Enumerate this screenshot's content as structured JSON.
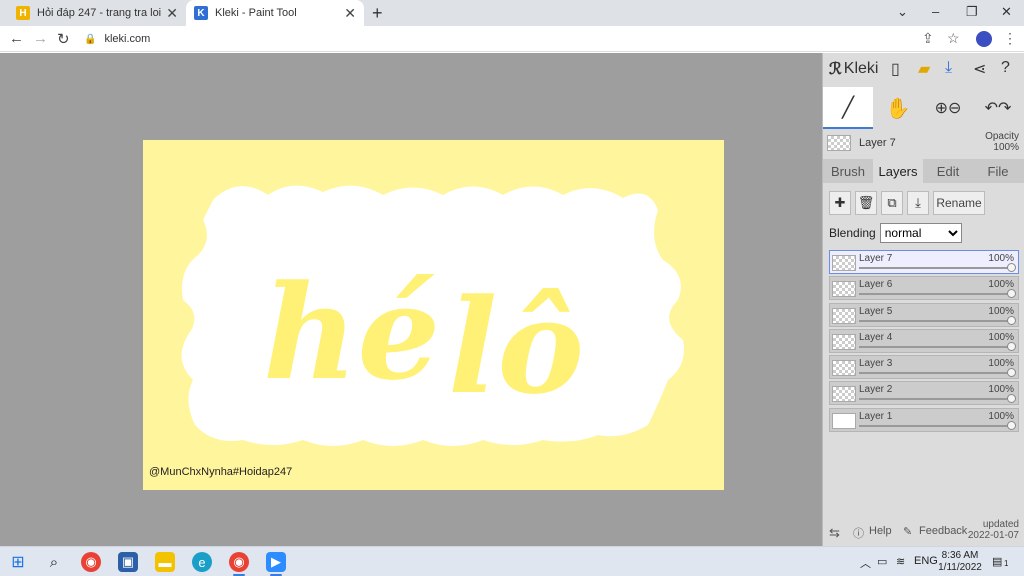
{
  "browser": {
    "tabs": [
      {
        "title": "Hỏi đáp 247 - trang tra loi",
        "favicon": "hoidap-favicon"
      },
      {
        "title": "Kleki - Paint Tool",
        "favicon": "kleki-favicon"
      }
    ],
    "new_tab": "+",
    "url": "kleki.com",
    "window_controls": {
      "minimize": "–",
      "maximize": "❐",
      "close": "✕",
      "dropdown": "⌄"
    }
  },
  "canvas": {
    "text_left": "hé",
    "text_right": "lô",
    "credit": "@MunChxNynha#Hoidap247",
    "colors": {
      "frame": "#fff59d",
      "letters": "#fff176",
      "background": "#ffffff"
    }
  },
  "panel": {
    "logo_text": "Kleki",
    "current_layer": "Layer 7",
    "opacity_label": "Opacity",
    "opacity_value": "100%",
    "tabs": [
      "Brush",
      "Layers",
      "Edit",
      "File"
    ],
    "active_tab": "Layers",
    "rename_label": "Rename",
    "blending_label": "Blending",
    "blending_value": "normal",
    "layers": [
      {
        "name": "Layer 7",
        "opacity": "100%"
      },
      {
        "name": "Layer 6",
        "opacity": "100%"
      },
      {
        "name": "Layer 5",
        "opacity": "100%"
      },
      {
        "name": "Layer 4",
        "opacity": "100%"
      },
      {
        "name": "Layer 3",
        "opacity": "100%"
      },
      {
        "name": "Layer 2",
        "opacity": "100%"
      },
      {
        "name": "Layer 1",
        "opacity": "100%"
      }
    ],
    "footer": {
      "help": "Help",
      "feedback": "Feedback",
      "updated_label": "updated",
      "updated_date": "2022-01-07"
    }
  },
  "taskbar": {
    "language": "ENG",
    "time": "8:36 AM",
    "date": "1/11/2022",
    "notifications": "1"
  }
}
